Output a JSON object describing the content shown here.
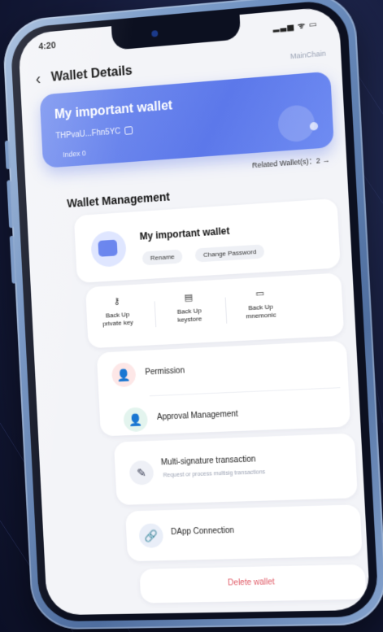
{
  "status_bar": {
    "time": "4:20",
    "icons": "▂▃▅ ᯤ ▭"
  },
  "header": {
    "back_icon": "‹",
    "title": "Wallet Details",
    "chain": "MainChain"
  },
  "wallet_card": {
    "name": "My important wallet",
    "address": "THPvaU...Fhn5YC",
    "index": "Index 0"
  },
  "related": {
    "label": "Related Wallet(s)：2 →"
  },
  "section": {
    "title": "Wallet Management"
  },
  "profile": {
    "name": "My important wallet",
    "rename": "Rename",
    "change_password": "Change Password"
  },
  "backup": {
    "items": [
      {
        "icon": "⚷",
        "line1": "Back Up",
        "line2": "private key"
      },
      {
        "icon": "▤",
        "line1": "Back Up",
        "line2": "keystore"
      },
      {
        "icon": "▭",
        "line1": "Back Up",
        "line2": "mnemonic"
      }
    ]
  },
  "permission": {
    "icon": "👤",
    "label": "Permission"
  },
  "approval": {
    "icon": "👤",
    "label": "Approval Management"
  },
  "multisig": {
    "icon": "✎",
    "label": "Multi-signature transaction",
    "sub": "Request or process multisig transactions"
  },
  "dapp": {
    "icon": "🔗",
    "label": "DApp Connection"
  },
  "delete": {
    "label": "Delete wallet"
  }
}
